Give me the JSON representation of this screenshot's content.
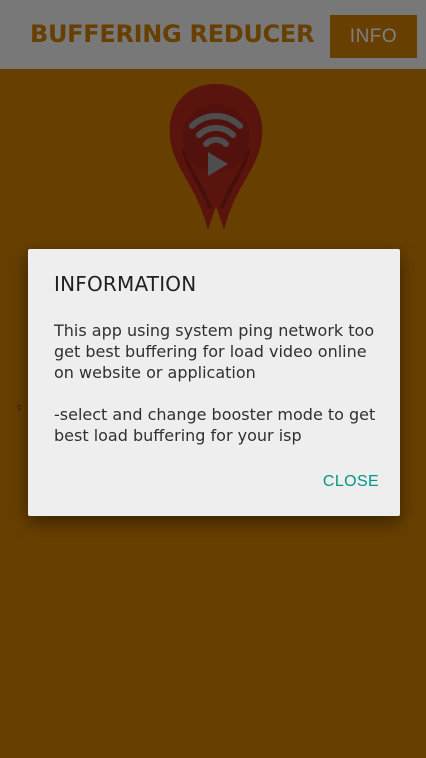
{
  "app_bar": {
    "title": "BUFFERING REDUCER",
    "info_button_label": "INFO"
  },
  "logo": {
    "icon": "wifi-rocket-logo-icon"
  },
  "dialog": {
    "title": "INFORMATION",
    "message": "This app using system ping network too get best buffering for load video online on website or application\n\n-select and change booster mode to get best load buffering for your isp",
    "close_label": "CLOSE"
  },
  "colors": {
    "accent": "#cf7e00",
    "dialog_background": "#eeeeee",
    "dialog_button": "#009688",
    "logo": "#b5291c"
  }
}
